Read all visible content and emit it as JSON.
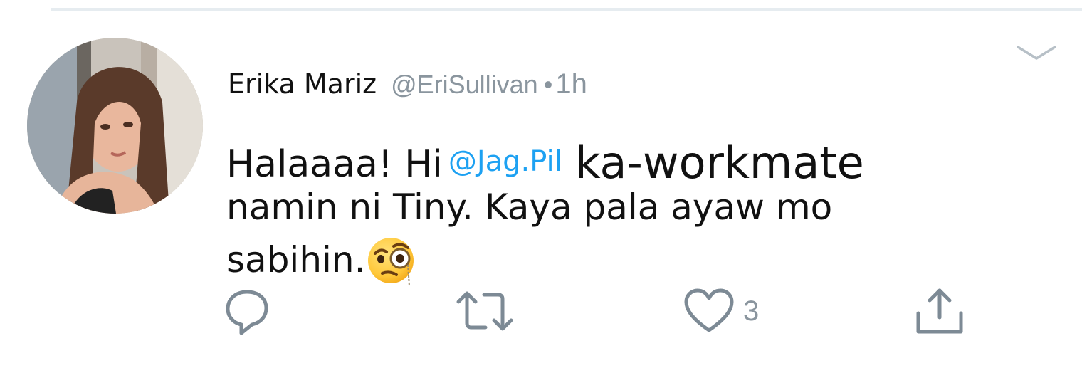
{
  "tweet": {
    "author_name": "Erika Mariz",
    "author_handle": "@EriSullivan",
    "separator": "•",
    "timestamp": "1h",
    "body": {
      "line1_start": "Halaaaa! Hi",
      "mention": "@Jag.Pil",
      "line1_end": "ka-workmate",
      "line2": "namin ni Tiny. Kaya pala ayaw mo",
      "line3": "sabihin."
    },
    "emoji": "face-with-monocle"
  },
  "actions": {
    "reply_icon": "reply-icon",
    "retweet_icon": "retweet-icon",
    "like_icon": "heart-icon",
    "like_count": "3",
    "share_icon": "share-icon"
  },
  "menu": {
    "icon": "chevron-down-icon"
  },
  "colors": {
    "mention": "#1da1f2",
    "muted": "#8a959e",
    "text": "#111111",
    "divider": "#e6ecf0"
  }
}
